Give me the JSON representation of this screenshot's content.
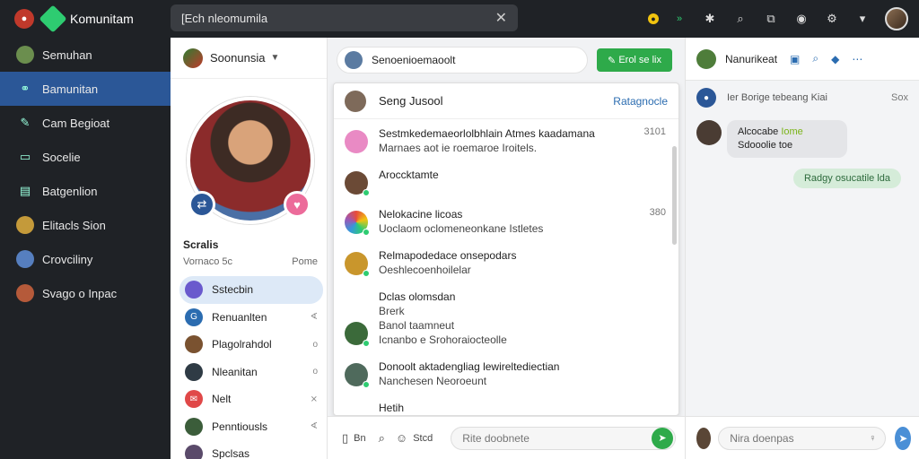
{
  "app": {
    "name": "Komunitam"
  },
  "search": {
    "value": "[Ech nleomumila"
  },
  "sidebar": {
    "items": [
      {
        "label": "Semuhan"
      },
      {
        "label": "Bamunitan"
      },
      {
        "label": "Cam Begioat"
      },
      {
        "label": "Socelie"
      },
      {
        "label": "Batgenlion"
      },
      {
        "label": "Elitacls Sion"
      },
      {
        "label": "Crovciliny"
      },
      {
        "label": "Svago o Inpac"
      }
    ]
  },
  "profile": {
    "header": "Soonunsia",
    "section_label": "Scralis",
    "sub_left": "Vornaco 5c",
    "sub_right": "Pome",
    "items": [
      {
        "label": "Sstecbin",
        "trail": ""
      },
      {
        "label": "Renuanlten",
        "trail": "∢"
      },
      {
        "label": "Plagolrahdol",
        "trail": "o"
      },
      {
        "label": "Nleanitan",
        "trail": "o"
      },
      {
        "label": "Nelt",
        "trail": "⨯"
      },
      {
        "label": "Penntiousls",
        "trail": "∢"
      },
      {
        "label": "Spclsas",
        "trail": ""
      }
    ]
  },
  "middle": {
    "pill": "Senoenioemaoolt",
    "action": "Erol se lix",
    "panel_title": "Seng Jusool",
    "panel_link": "Ratagnocle",
    "rows": [
      {
        "title": "Sestmkedemaeorlolbhlain Atmes kaadamana",
        "sub": "Marnaes aot ie roemaroe Iroitels.",
        "meta": "3101"
      },
      {
        "title": "Aroccktamte",
        "sub": "",
        "meta": ""
      },
      {
        "title": "Nelokacine licoas",
        "sub": "Uoclaom oclomeneonkane Istletes",
        "meta": "380"
      },
      {
        "title": "Relmapodedace onsepodars",
        "sub": "Oeshlecoenhoilelar",
        "meta": ""
      },
      {
        "title": "Dclas olomsdan",
        "sub": "Brerk",
        "sub2": "Banol taamneut",
        "sub3": "Icnanbo e Srohoraiocteolle",
        "meta": ""
      },
      {
        "title": "Donoolt aktadengliag lewireltediectian",
        "sub": "Nanchesen Neoroeunt",
        "meta": ""
      },
      {
        "title": "Hetih",
        "sub": "",
        "meta": ""
      }
    ],
    "foot_btn1": "Bn",
    "foot_btn2": "Stcd",
    "compose_placeholder": "Rite doobnete"
  },
  "right": {
    "header": "Nanurikeat",
    "notice": "Ier Borige tebeang Kiai",
    "notice_close": "Sox",
    "incoming_name": "Alcocabe",
    "incoming_hl": "Iome",
    "incoming_text": "Sdooolie toe",
    "outgoing_text": "Radgy osucatile lda",
    "compose_placeholder": "Nira doenpas"
  }
}
